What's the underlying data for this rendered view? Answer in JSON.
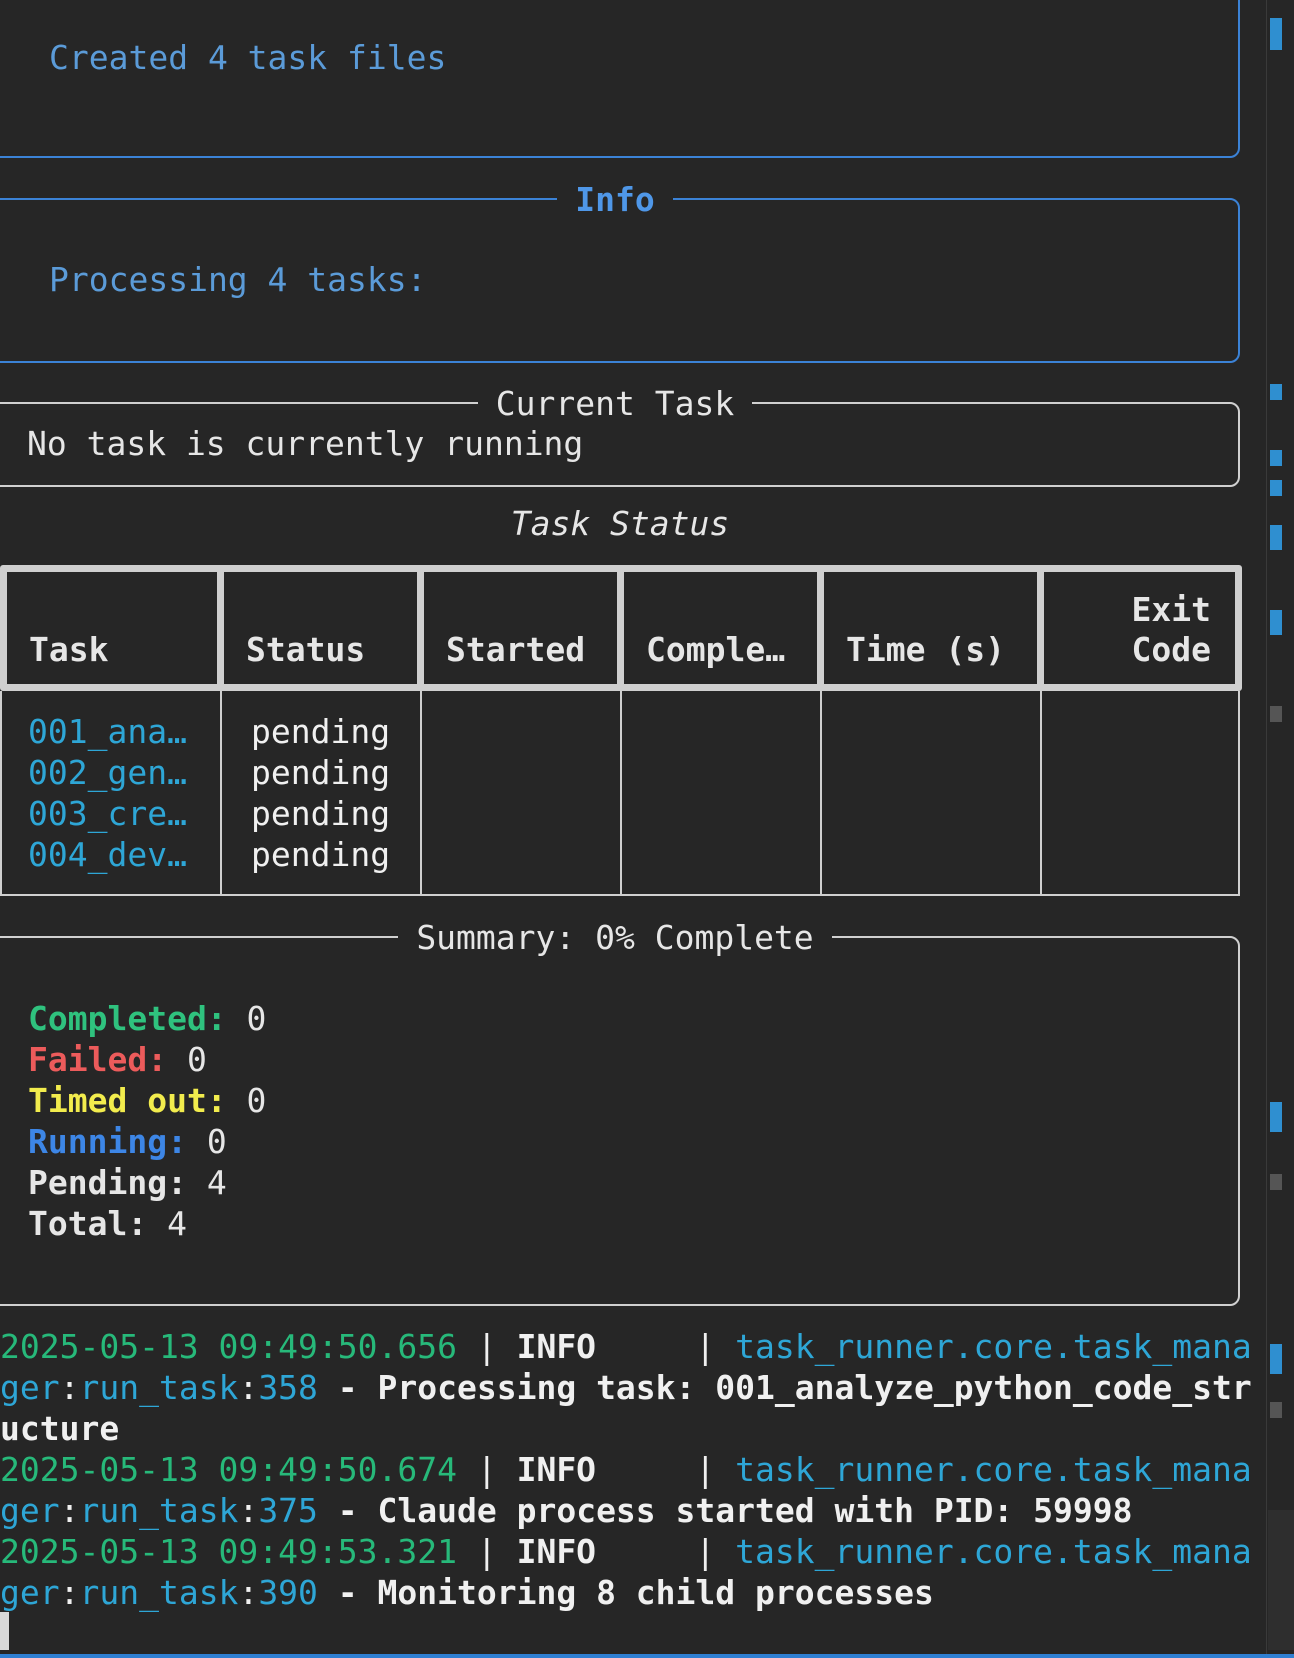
{
  "top_panel": {
    "text": "Created 4 task files"
  },
  "info_panel": {
    "title": "Info",
    "text": "Processing 4 tasks:"
  },
  "current_task": {
    "title": "Current Task",
    "text": "No task is currently running"
  },
  "task_table": {
    "caption": "Task Status",
    "headers": [
      "Task",
      "Status",
      "Started",
      "Comple…",
      "Time (s)",
      "Exit Code"
    ],
    "exit_header_line1": "Exit",
    "exit_header_line2": "Code",
    "rows": [
      {
        "task": "001_ana…",
        "status": "pending",
        "started": "",
        "completed": "",
        "time": "",
        "exit": ""
      },
      {
        "task": "002_gen…",
        "status": "pending",
        "started": "",
        "completed": "",
        "time": "",
        "exit": ""
      },
      {
        "task": "003_cre…",
        "status": "pending",
        "started": "",
        "completed": "",
        "time": "",
        "exit": ""
      },
      {
        "task": "004_dev…",
        "status": "pending",
        "started": "",
        "completed": "",
        "time": "",
        "exit": ""
      }
    ]
  },
  "summary": {
    "title": "Summary: 0% Complete",
    "items": [
      {
        "label": "Completed:",
        "value": "0",
        "color": "#2fc27e"
      },
      {
        "label": "Failed:",
        "value": "0",
        "color": "#ec5b5b"
      },
      {
        "label": "Timed out:",
        "value": "0",
        "color": "#f2ec4d"
      },
      {
        "label": "Running:",
        "value": "0",
        "color": "#3d86e6"
      },
      {
        "label": "Pending:",
        "value": "4",
        "color": "#e6e6e6"
      },
      {
        "label": "Total:",
        "value": "4",
        "color": "#e6e6e6"
      }
    ]
  },
  "log": {
    "lines": [
      {
        "parts": [
          [
            "ts",
            "2025-05-13 09:49:50.656"
          ],
          [
            "pipe",
            " | "
          ],
          [
            "lvl",
            "INFO"
          ],
          [
            "pipe",
            "     | "
          ],
          [
            "mod",
            "task_runner.core.task_mana"
          ]
        ]
      },
      {
        "parts": [
          [
            "mod",
            "ger"
          ],
          [
            "pipe",
            ":"
          ],
          [
            "mod",
            "run_task"
          ],
          [
            "pipe",
            ":"
          ],
          [
            "mod",
            "358"
          ],
          [
            "msg",
            " - Processing task: 001_analyze_python_code_str"
          ]
        ]
      },
      {
        "parts": [
          [
            "msg",
            "ucture"
          ]
        ]
      },
      {
        "parts": [
          [
            "ts",
            "2025-05-13 09:49:50.674"
          ],
          [
            "pipe",
            " | "
          ],
          [
            "lvl",
            "INFO"
          ],
          [
            "pipe",
            "     | "
          ],
          [
            "mod",
            "task_runner.core.task_mana"
          ]
        ]
      },
      {
        "parts": [
          [
            "mod",
            "ger"
          ],
          [
            "pipe",
            ":"
          ],
          [
            "mod",
            "run_task"
          ],
          [
            "pipe",
            ":"
          ],
          [
            "mod",
            "375"
          ],
          [
            "msg",
            " - Claude process started with PID: 59998"
          ]
        ]
      },
      {
        "parts": [
          [
            "ts",
            "2025-05-13 09:49:53.321"
          ],
          [
            "pipe",
            " | "
          ],
          [
            "lvl",
            "INFO"
          ],
          [
            "pipe",
            "     | "
          ],
          [
            "mod",
            "task_runner.core.task_mana"
          ]
        ]
      },
      {
        "parts": [
          [
            "mod",
            "ger"
          ],
          [
            "pipe",
            ":"
          ],
          [
            "mod",
            "run_task"
          ],
          [
            "pipe",
            ":"
          ],
          [
            "mod",
            "390"
          ],
          [
            "msg",
            " - Monitoring 8 child processes"
          ]
        ]
      }
    ]
  },
  "colors": {
    "background": "#262626",
    "panel_blue": "#3b82d6",
    "panel_gray": "#d0d0d0",
    "task_name": "#2ea6d6",
    "timestamp": "#27b97a"
  }
}
